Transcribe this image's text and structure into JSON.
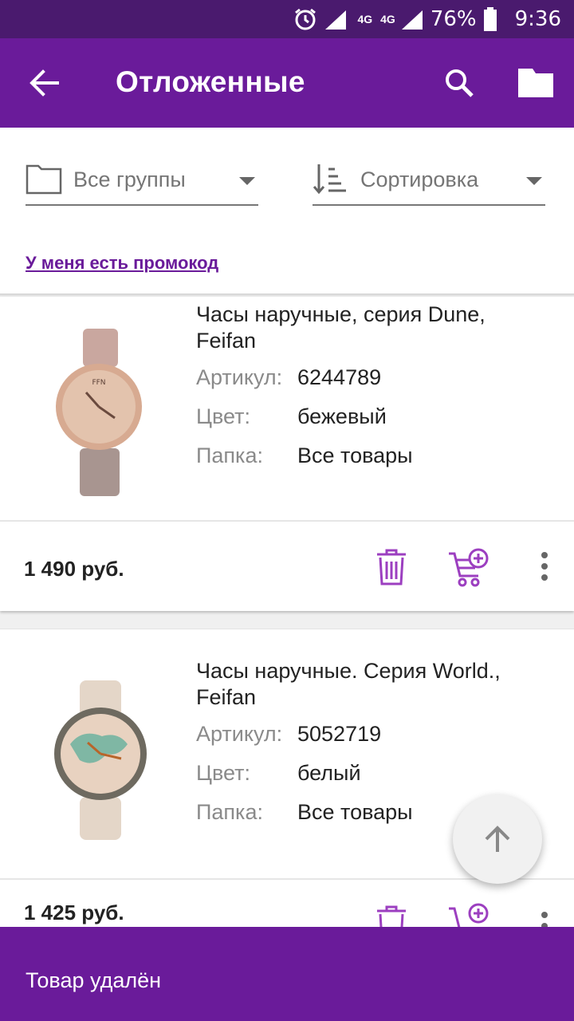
{
  "status_bar": {
    "network_label_1": "4G",
    "network_label_2": "4G",
    "battery": "76%",
    "time": "9:36"
  },
  "app_bar": {
    "title": "Отложенные",
    "icons": [
      "arrow-back-icon",
      "search-icon",
      "folder-icon"
    ]
  },
  "filters": {
    "groups_label": "Все группы",
    "sort_label": "Сортировка",
    "promo_link": "У меня есть промокод"
  },
  "products": [
    {
      "name": "Часы наручные, серия Dune, Feifan",
      "article_key": "Артикул:",
      "article": "6244789",
      "color_key": "Цвет:",
      "color": "бежевый",
      "folder_key": "Папка:",
      "folder": "Все товары",
      "price": "1 490 руб."
    },
    {
      "name": "Часы наручные. Серия World., Feifan",
      "article_key": "Артикул:",
      "article": "5052719",
      "color_key": "Цвет:",
      "color": "белый",
      "folder_key": "Папка:",
      "folder": "Все товары",
      "price": "1 425 руб."
    }
  ],
  "snackbar": {
    "message": "Товар удалён"
  },
  "colors": {
    "primary": "#6a1b9a",
    "status_bar": "#4a1a6e",
    "accent_icon": "#9c3fc0"
  }
}
